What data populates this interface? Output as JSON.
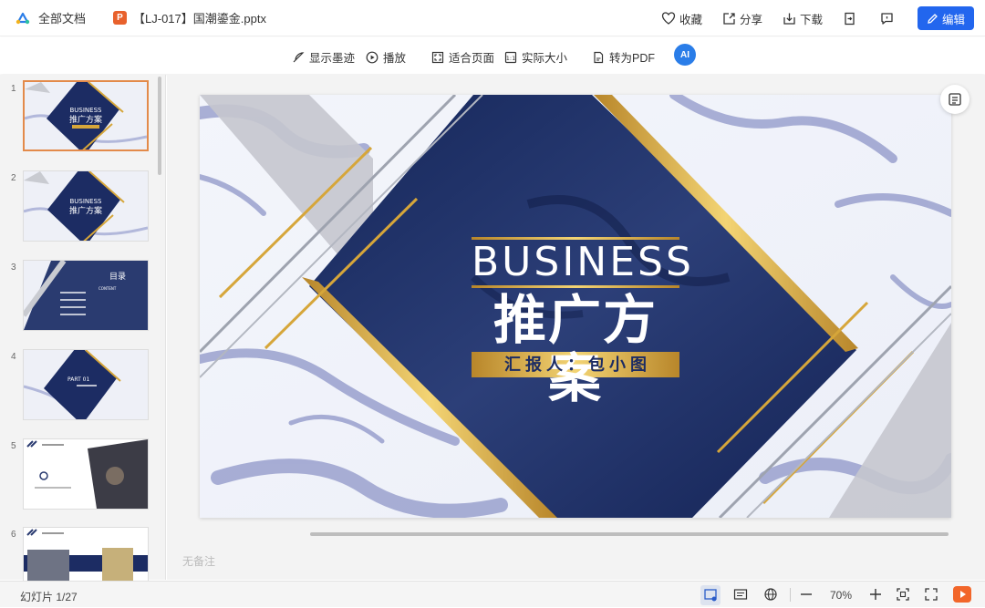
{
  "header": {
    "all_docs": "全部文档",
    "file_icon": "P",
    "file_name": "【LJ-017】国潮鎏金.pptx",
    "favorite": "收藏",
    "share": "分享",
    "download": "下载",
    "edit": "编辑"
  },
  "toolbar": {
    "show_ink": "显示墨迹",
    "play": "播放",
    "fit_page": "适合页面",
    "actual_size": "实际大小",
    "to_pdf": "转为PDF",
    "ai": "AI"
  },
  "thumbnails": [
    {
      "num": "1",
      "en": "BUSINESS",
      "cn": "推广方案"
    },
    {
      "num": "2",
      "en": "BUSINESS",
      "cn": "推广方案"
    },
    {
      "num": "3",
      "title": "目录",
      "en": "CONTENT"
    },
    {
      "num": "4",
      "en": "PART 01"
    },
    {
      "num": "5"
    },
    {
      "num": "6"
    }
  ],
  "slide": {
    "title_en": "BUSINESS",
    "title_cn": "推广方案",
    "reporter": "汇 报 人 ： 包 小 图"
  },
  "notes_placeholder": "无备注",
  "status": {
    "slide_count": "幻灯片 1/27",
    "zoom": "70%"
  },
  "colors": {
    "accent": "#2266ee",
    "navy": "#1c2c63",
    "gold": "#d6a63a",
    "selection": "#e38a4a"
  }
}
